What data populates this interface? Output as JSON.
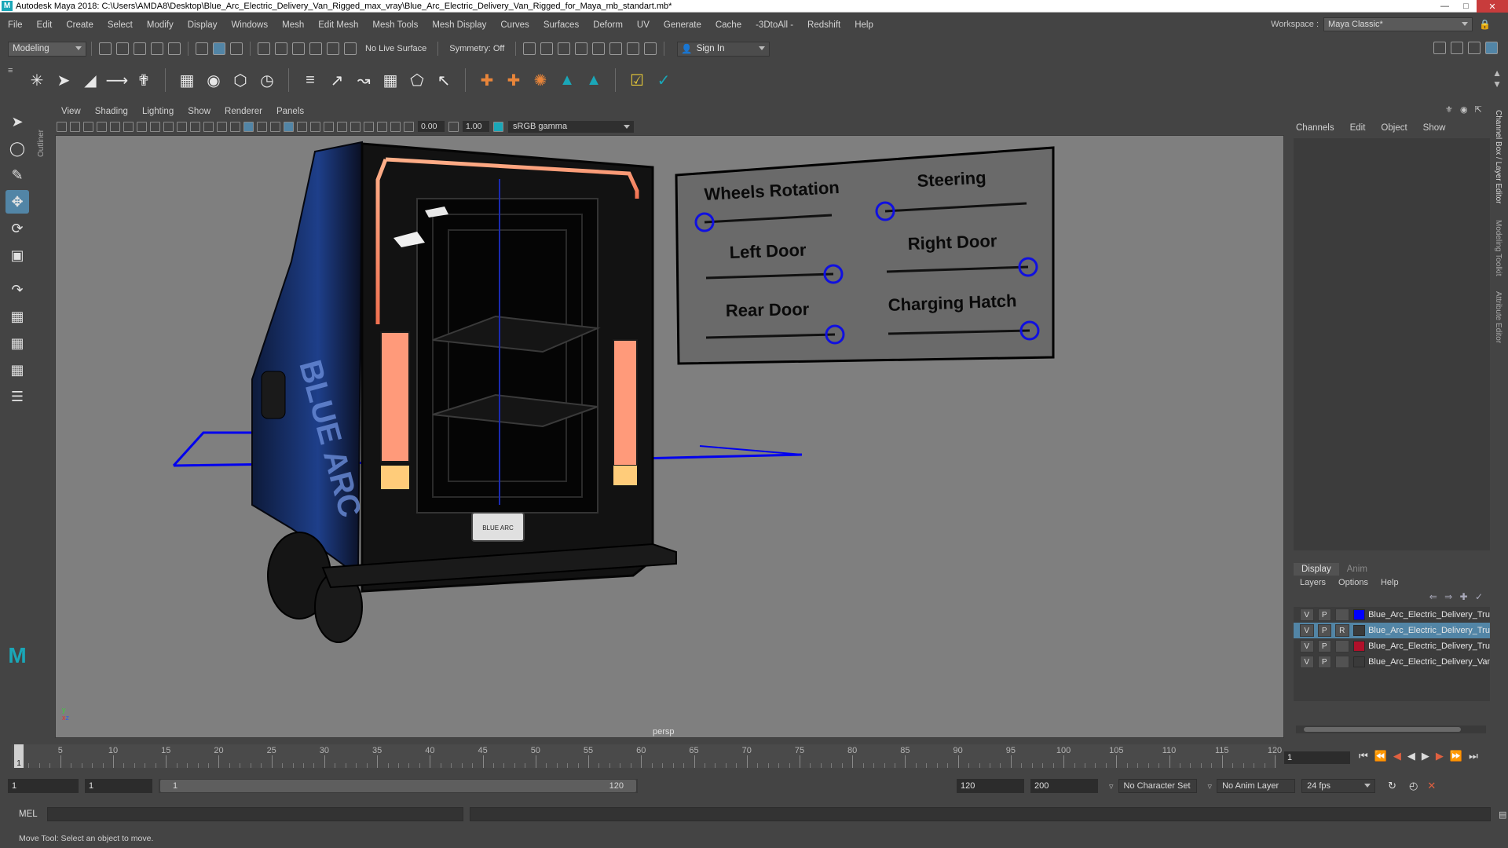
{
  "title_bar": {
    "title": "Autodesk Maya 2018: C:\\Users\\AMDA8\\Desktop\\Blue_Arc_Electric_Delivery_Van_Rigged_max_vray\\Blue_Arc_Electric_Delivery_Van_Rigged_for_Maya_mb_standart.mb*",
    "logo": "M"
  },
  "menu": [
    "File",
    "Edit",
    "Create",
    "Select",
    "Modify",
    "Display",
    "Windows",
    "Mesh",
    "Edit Mesh",
    "Mesh Tools",
    "Mesh Display",
    "Curves",
    "Surfaces",
    "Deform",
    "UV",
    "Generate",
    "Cache",
    "-3DtoAll -",
    "Redshift",
    "Help"
  ],
  "workspace": {
    "label": "Workspace :",
    "value": "Maya Classic*"
  },
  "status_line": {
    "mode": "Modeling",
    "live_surface": "No Live Surface",
    "symmetry": "Symmetry: Off",
    "sign_in": "Sign In"
  },
  "panel_menu": [
    "View",
    "Shading",
    "Lighting",
    "Show",
    "Renderer",
    "Panels"
  ],
  "panel_toolbar": {
    "field1": "0.00",
    "field2": "1.00",
    "color_space": "sRGB gamma"
  },
  "viewport": {
    "camera_label": "persp",
    "vehicle_logo": "BLUE ARC",
    "side_text": "BLUE ARC"
  },
  "controls": {
    "wheels_rotation": {
      "label": "Wheels Rotation",
      "value": 0
    },
    "steering": {
      "label": "Steering",
      "value": 0
    },
    "left_door": {
      "label": "Left Door",
      "value": 1
    },
    "right_door": {
      "label": "Right Door",
      "value": 1
    },
    "rear_door": {
      "label": "Rear Door",
      "value": 1
    },
    "charging_hatch": {
      "label": "Charging Hatch",
      "value": 1
    }
  },
  "outliner_tab": "Outliner",
  "channel_box": {
    "menu": [
      "Channels",
      "Edit",
      "Object",
      "Show"
    ]
  },
  "layer_editor": {
    "tabs": [
      "Display",
      "Anim"
    ],
    "menu": [
      "Layers",
      "Options",
      "Help"
    ],
    "layers": [
      {
        "v": "V",
        "p": "P",
        "r": "",
        "color": "#0000ff",
        "name": "Blue_Arc_Electric_Delivery_Truc"
      },
      {
        "v": "V",
        "p": "P",
        "r": "R",
        "color": "#3a3a3a",
        "name": "Blue_Arc_Electric_Delivery_Truc"
      },
      {
        "v": "V",
        "p": "P",
        "r": "",
        "color": "#b0102a",
        "name": "Blue_Arc_Electric_Delivery_Truc"
      },
      {
        "v": "V",
        "p": "P",
        "r": "",
        "color": "#3a3a3a",
        "name": "Blue_Arc_Electric_Delivery_Van"
      }
    ]
  },
  "side_tabs": [
    "Channel Box / Layer Editor",
    "Modeling Toolkit",
    "Attribute Editor"
  ],
  "time_slider": {
    "ticks": [
      "5",
      "10",
      "15",
      "20",
      "25",
      "30",
      "35",
      "40",
      "45",
      "50",
      "55",
      "60",
      "65",
      "70",
      "75",
      "80",
      "85",
      "90",
      "95",
      "100",
      "105",
      "110",
      "115",
      "120"
    ],
    "current": "1",
    "frame_field": "1"
  },
  "range": {
    "start": "1",
    "playback_start": "1",
    "slider_start": "1",
    "slider_end": "120",
    "playback_end": "120",
    "end": "200",
    "character_set": "No Character Set",
    "anim_layer": "No Anim Layer",
    "fps": "24 fps"
  },
  "command_line": {
    "label": "MEL"
  },
  "help_line": "Move Tool: Select an object to move."
}
